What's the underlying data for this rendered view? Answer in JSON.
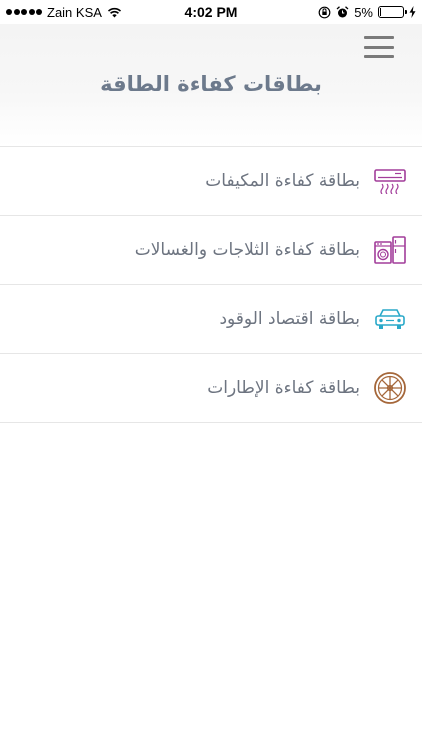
{
  "status_bar": {
    "carrier": "Zain KSA",
    "time": "4:02 PM",
    "battery_percent": "5%",
    "battery_level": 0.05
  },
  "header": {
    "title": "بطاقات كفاءة الطاقة",
    "menu_icon": "hamburger-menu-icon"
  },
  "items": [
    {
      "label": "بطاقة كفاءة المكيفات",
      "icon": "air-conditioner-icon",
      "color": "#a23d9a"
    },
    {
      "label": "بطاقة كفاءة الثلاجات والغسالات",
      "icon": "fridge-washer-icon",
      "color": "#a23d9a"
    },
    {
      "label": "بطاقة اقتصاد الوقود",
      "icon": "car-icon",
      "color": "#2aa9c9"
    },
    {
      "label": "بطاقة كفاءة الإطارات",
      "icon": "tire-icon",
      "color": "#a5673a"
    }
  ]
}
